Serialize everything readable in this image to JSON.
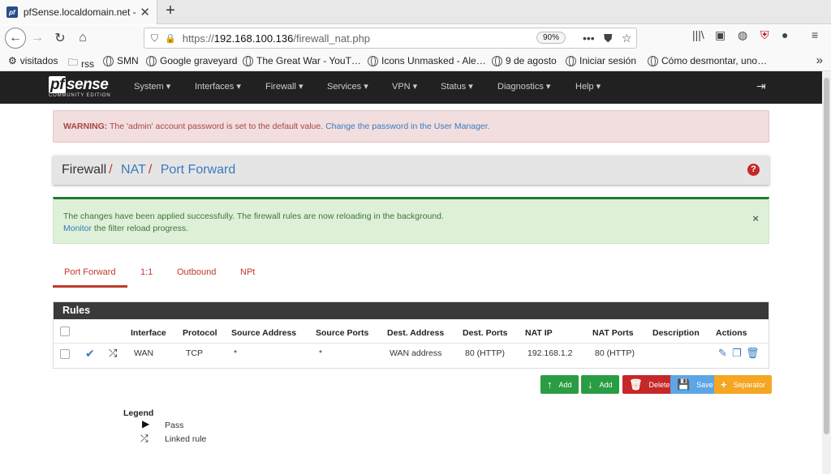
{
  "browser": {
    "tab_title": "pfSense.localdomain.net - F",
    "url_scheme": "https://",
    "url_host": "192.168.100.136",
    "url_path": "/firewall_nat.php",
    "zoom": "90%",
    "bookmarks": [
      "visitados",
      "rss",
      "SMN",
      "Google graveyard",
      "The Great War - YouT…",
      "Icons Unmasked - Ale…",
      "9 de agosto",
      "Iniciar sesión",
      "Cómo desmontar, uno…"
    ]
  },
  "pfsense": {
    "logo_main": "sense",
    "logo_pf": "pf",
    "logo_sub": "COMMUNITY EDITION",
    "menu": [
      "System ▾",
      "Interfaces ▾",
      "Firewall ▾",
      "Services ▾",
      "VPN ▾",
      "Status ▾",
      "Diagnostics ▾",
      "Help ▾"
    ]
  },
  "warning": {
    "label": "WARNING:",
    "text": " The 'admin' account password is set to the default value. ",
    "link": "Change the password in the User Manager."
  },
  "breadcrumb": {
    "item1": "Firewall",
    "item2": "NAT",
    "item3": "Port Forward",
    "sep": "/"
  },
  "success": {
    "line1": "The changes have been applied successfully. The firewall rules are now reloading in the background.",
    "monitor_link": "Monitor",
    "line2_rest": " the filter reload progress."
  },
  "tabs": [
    "Port Forward",
    "1:1",
    "Outbound",
    "NPt"
  ],
  "rules": {
    "title": "Rules",
    "columns": [
      "Interface",
      "Protocol",
      "Source Address",
      "Source Ports",
      "Dest. Address",
      "Dest. Ports",
      "NAT IP",
      "NAT Ports",
      "Description",
      "Actions"
    ],
    "rows": [
      {
        "interface": "WAN",
        "protocol": "TCP",
        "src_addr": "*",
        "src_ports": "*",
        "dst_addr": "WAN address",
        "dst_ports": "80 (HTTP)",
        "nat_ip": "192.168.1.2",
        "nat_ports": "80 (HTTP)",
        "description": ""
      }
    ]
  },
  "buttons": {
    "add_top": "Add",
    "add_bottom": "Add",
    "delete": "Delete",
    "save": "Save",
    "separator": "Separator"
  },
  "legend": {
    "title": "Legend",
    "pass": "Pass",
    "linked": "Linked rule"
  }
}
